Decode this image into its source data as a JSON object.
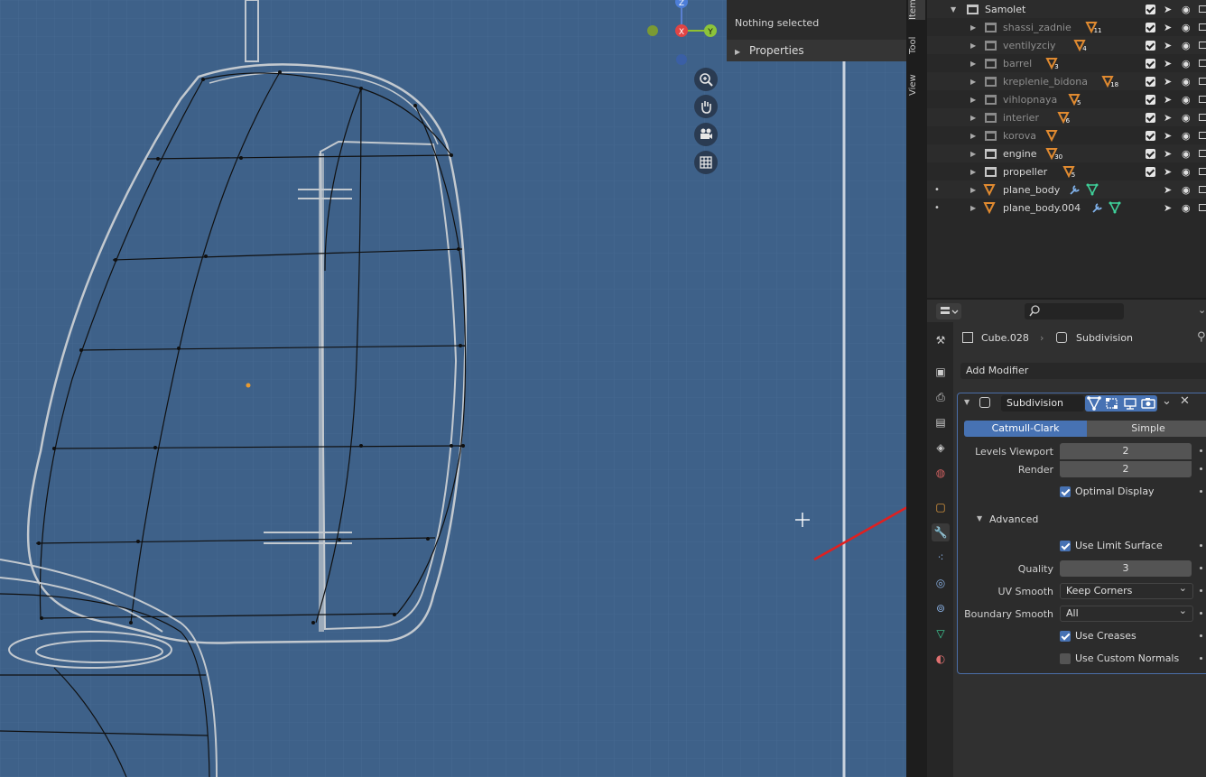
{
  "viewport": {
    "n_panel": {
      "header_text": "Nothing selected",
      "section_label": "Properties"
    },
    "axis": {
      "z": "Z",
      "x": "X",
      "y": "Y"
    },
    "tabs": [
      "Item",
      "Tool",
      "View"
    ],
    "navigation_icons": [
      "zoom-icon",
      "pan-hand-icon",
      "camera-icon",
      "grid-icon"
    ]
  },
  "outliner": {
    "root": "Samolet",
    "items": [
      {
        "name": "shassi_zadnie",
        "count": "11",
        "dim": true
      },
      {
        "name": "ventilyzciy",
        "count": "4",
        "dim": true
      },
      {
        "name": "barrel",
        "count": "3",
        "dim": true
      },
      {
        "name": "kreplenie_bidona",
        "count": "18",
        "dim": true
      },
      {
        "name": "vihlopnaya",
        "count": "5",
        "dim": true
      },
      {
        "name": "interier",
        "count": "6",
        "dim": true
      },
      {
        "name": "korova",
        "count": "",
        "dim": true
      },
      {
        "name": "engine",
        "count": "30",
        "dim": false
      },
      {
        "name": "propeller",
        "count": "5",
        "dim": false
      },
      {
        "name": "plane_body",
        "count": "",
        "dim": false
      },
      {
        "name": "plane_body.004",
        "count": "",
        "dim": false
      }
    ]
  },
  "properties": {
    "breadcrumb": {
      "object": "Cube.028",
      "modifier": "Subdivision"
    },
    "add_modifier_label": "Add Modifier",
    "modifier": {
      "name": "Subdivision",
      "tabs": {
        "catmull": "Catmull-Clark",
        "simple": "Simple"
      },
      "levels_viewport_label": "Levels Viewport",
      "levels_viewport_value": "2",
      "render_label": "Render",
      "render_value": "2",
      "optimal_display_label": "Optimal Display",
      "advanced_label": "Advanced",
      "use_limit_surface_label": "Use Limit Surface",
      "quality_label": "Quality",
      "quality_value": "3",
      "uv_smooth_label": "UV Smooth",
      "uv_smooth_value": "Keep Corners",
      "boundary_smooth_label": "Boundary Smooth",
      "boundary_smooth_value": "All",
      "use_creases_label": "Use Creases",
      "use_custom_normals_label": "Use Custom Normals"
    }
  },
  "colors": {
    "viewport_bg": "#3e6189",
    "accent_blue": "#4772b3",
    "annotation_red": "#e02020",
    "object_orange": "#d48a3a",
    "mesh_green": "#3fd19a"
  }
}
